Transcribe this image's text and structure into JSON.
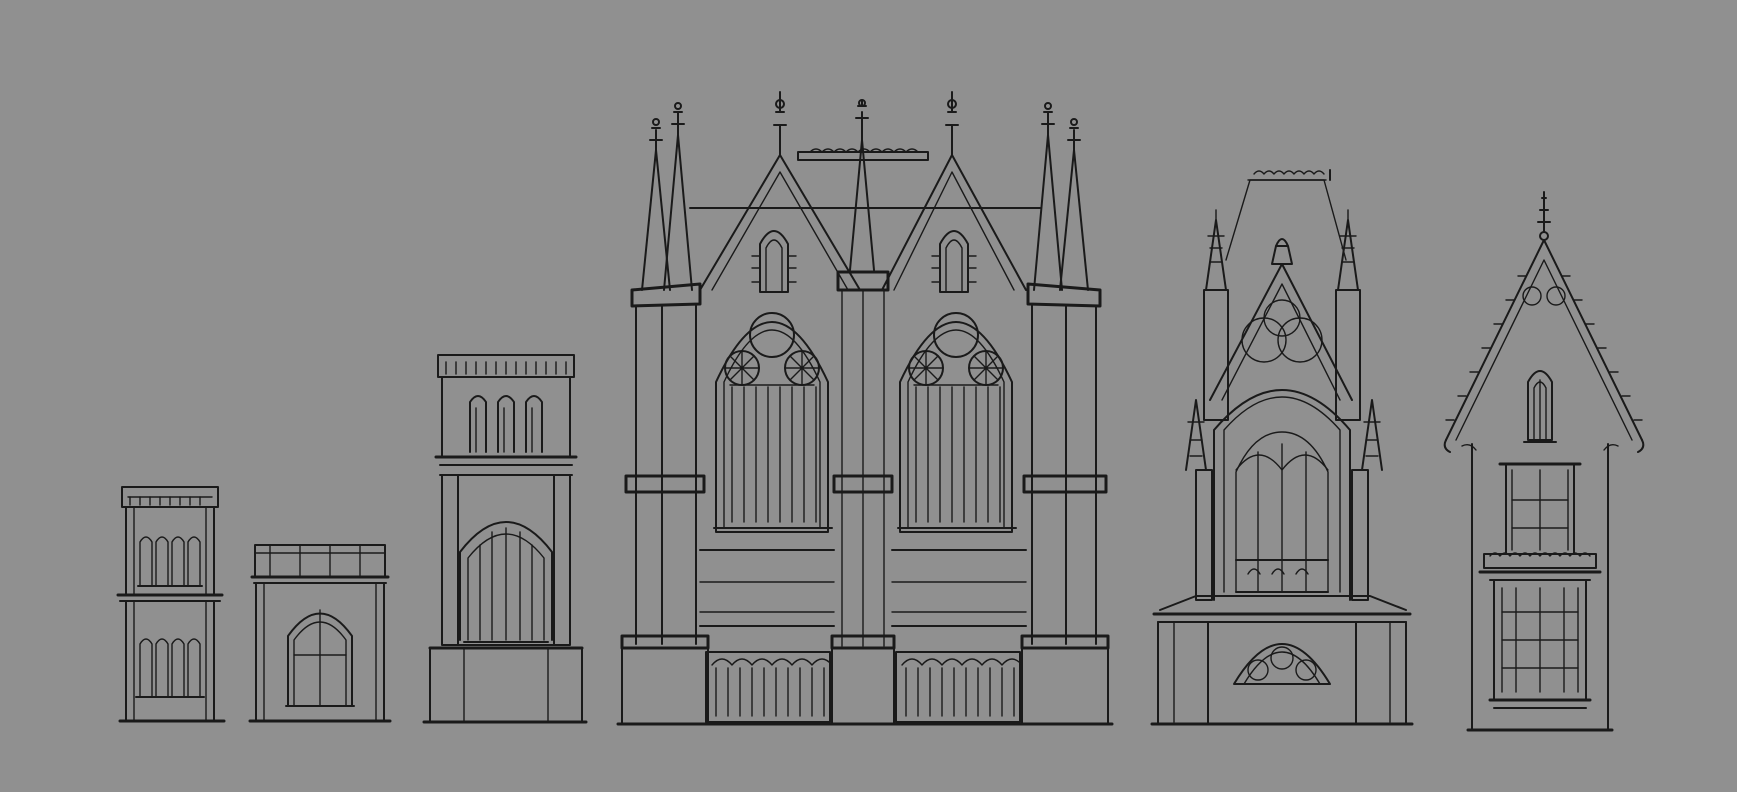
{
  "canvas": {
    "background": "#909090",
    "ink": "#1a1a1a"
  },
  "buildings": [
    {
      "id": "small-tower",
      "kind": "two-storey tower with tracery windows"
    },
    {
      "id": "gatehouse",
      "kind": "low block with arched doorway"
    },
    {
      "id": "bell-tower",
      "kind": "tall tower with lancet windows and arched gate"
    },
    {
      "id": "cathedral-facade",
      "kind": "twin-gable gothic facade with rose-arched windows and pinnacles"
    },
    {
      "id": "ornate-chapel",
      "kind": "spired chapel with large traceried window and rose window"
    },
    {
      "id": "gabled-house",
      "kind": "narrow gabled house with finial, balcony and bay window"
    }
  ]
}
